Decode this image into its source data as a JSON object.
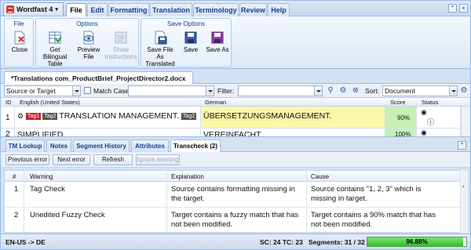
{
  "ribbon": {
    "app_menu": "Wordfast 4",
    "tabs": [
      "File",
      "Edit",
      "Formatting",
      "Translation",
      "Terminology",
      "Review",
      "Help"
    ],
    "active_tab": "File",
    "groups": {
      "file": {
        "title": "File",
        "close": "Close"
      },
      "options": {
        "title": "Options",
        "bilingual_1": "Get Bilingual",
        "bilingual_2": "Table",
        "preview_1": "Preview",
        "preview_2": "File",
        "instructions_1": "Show",
        "instructions_2": "Instructions"
      },
      "save": {
        "title": "Save Options",
        "save_translated_1": "Save File As",
        "save_translated_2": "Translated",
        "save": "Save",
        "save_as": "Save As"
      }
    }
  },
  "document_tab": "*Translations com_ProductBrief_ProjectDirector2.docx",
  "filter_bar": {
    "scope": "Source or Target",
    "match_case": "Match Case",
    "filter_label": "Filter:",
    "sort_label": "Sort:",
    "sort_value": "Document"
  },
  "grid": {
    "headers": {
      "id": "ID",
      "source": "English (United States)",
      "target": "German",
      "score": "Score",
      "status": "Status"
    },
    "rows": [
      {
        "id": "1",
        "tag1": "Tag1",
        "tag2": "Tag2",
        "source": "TRANSLATION MANAGEMENT.",
        "tag_end": "Tag2",
        "target": "ÜBERSETZUNGSMANAGEMENT.",
        "score": "90%"
      },
      {
        "id": "2",
        "source": "SIMPLIFIED.",
        "target": "VEREINFACHT.",
        "score": "100%"
      }
    ]
  },
  "bottom_tabs": [
    "TM Lookup",
    "Notes",
    "Segment History",
    "Attributes",
    "Transcheck (2)"
  ],
  "bottom_active": "Transcheck (2)",
  "transcheck_buttons": {
    "previous": "Previous error",
    "next": "Next error",
    "refresh": "Refresh",
    "ignore": "Ignore warning"
  },
  "warnings": {
    "headers": {
      "num": "#",
      "warning": "Warning",
      "explanation": "Explanation",
      "cause": "Cause"
    },
    "rows": [
      {
        "num": "1",
        "warning": "Tag Check",
        "explanation_1": "Source contains formatting missing in",
        "explanation_2": "the target.",
        "cause_1": "Source contains \"1, 2, 3\" which is",
        "cause_2": "missing in target."
      },
      {
        "num": "2",
        "warning": "Unedited Fuzzy Check",
        "explanation_1": "Target contains a fuzzy match that has",
        "explanation_2": "not been modified.",
        "cause_1": "Target contains a 90% match that has",
        "cause_2": "not been modified."
      }
    ]
  },
  "status_bar": {
    "language_pair": "EN-US -> DE",
    "counts": "SC: 24 TC: 23",
    "segments": "Segments: 31 / 32",
    "progress_text": "96.88%",
    "progress_value": 0.9688
  },
  "colors": {
    "target_bg": "#fbf7a8",
    "score_bg": "#c6f0b4",
    "tag_red": "#c8232c",
    "tag_dark": "#555555",
    "progress": "#2ec12a"
  },
  "icons": [
    "close-doc-icon",
    "bilingual-table-icon",
    "preview-icon",
    "instructions-icon",
    "save-translated-icon",
    "save-icon",
    "save-as-icon",
    "search-icon",
    "filter-settings-icon",
    "clear-filter-icon",
    "sort-settings-icon"
  ]
}
